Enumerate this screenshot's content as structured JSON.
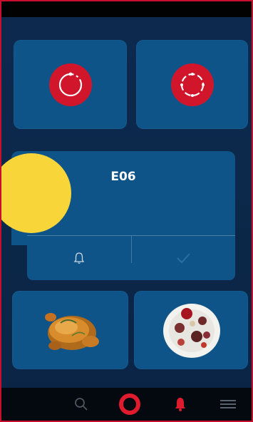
{
  "screen": {
    "error_code": "E06"
  },
  "tiles": [
    {
      "name": "program-tile-1",
      "icon": "single-dotted-ring-icon"
    },
    {
      "name": "program-tile-2",
      "icon": "segmented-ring-icon"
    }
  ],
  "error_actions": [
    {
      "name": "bell-action",
      "icon": "bell-icon"
    },
    {
      "name": "confirm-action",
      "icon": "checkmark-icon"
    }
  ],
  "recipes": [
    {
      "name": "roast-chicken",
      "icon": "roast-chicken-image"
    },
    {
      "name": "mixed-dish-plate",
      "icon": "plate-of-food-image"
    }
  ],
  "bottom_nav": [
    {
      "name": "search",
      "icon": "search-icon"
    },
    {
      "name": "home",
      "icon": "red-ring-logo-icon"
    },
    {
      "name": "alerts",
      "icon": "bell-icon"
    },
    {
      "name": "menu",
      "icon": "hamburger-menu-icon"
    }
  ],
  "colors": {
    "background": "#0b2748",
    "tile": "#0f5489",
    "brand_red": "#d1162b",
    "highlight_marker": "#f8d63a",
    "bars": "#020202"
  }
}
